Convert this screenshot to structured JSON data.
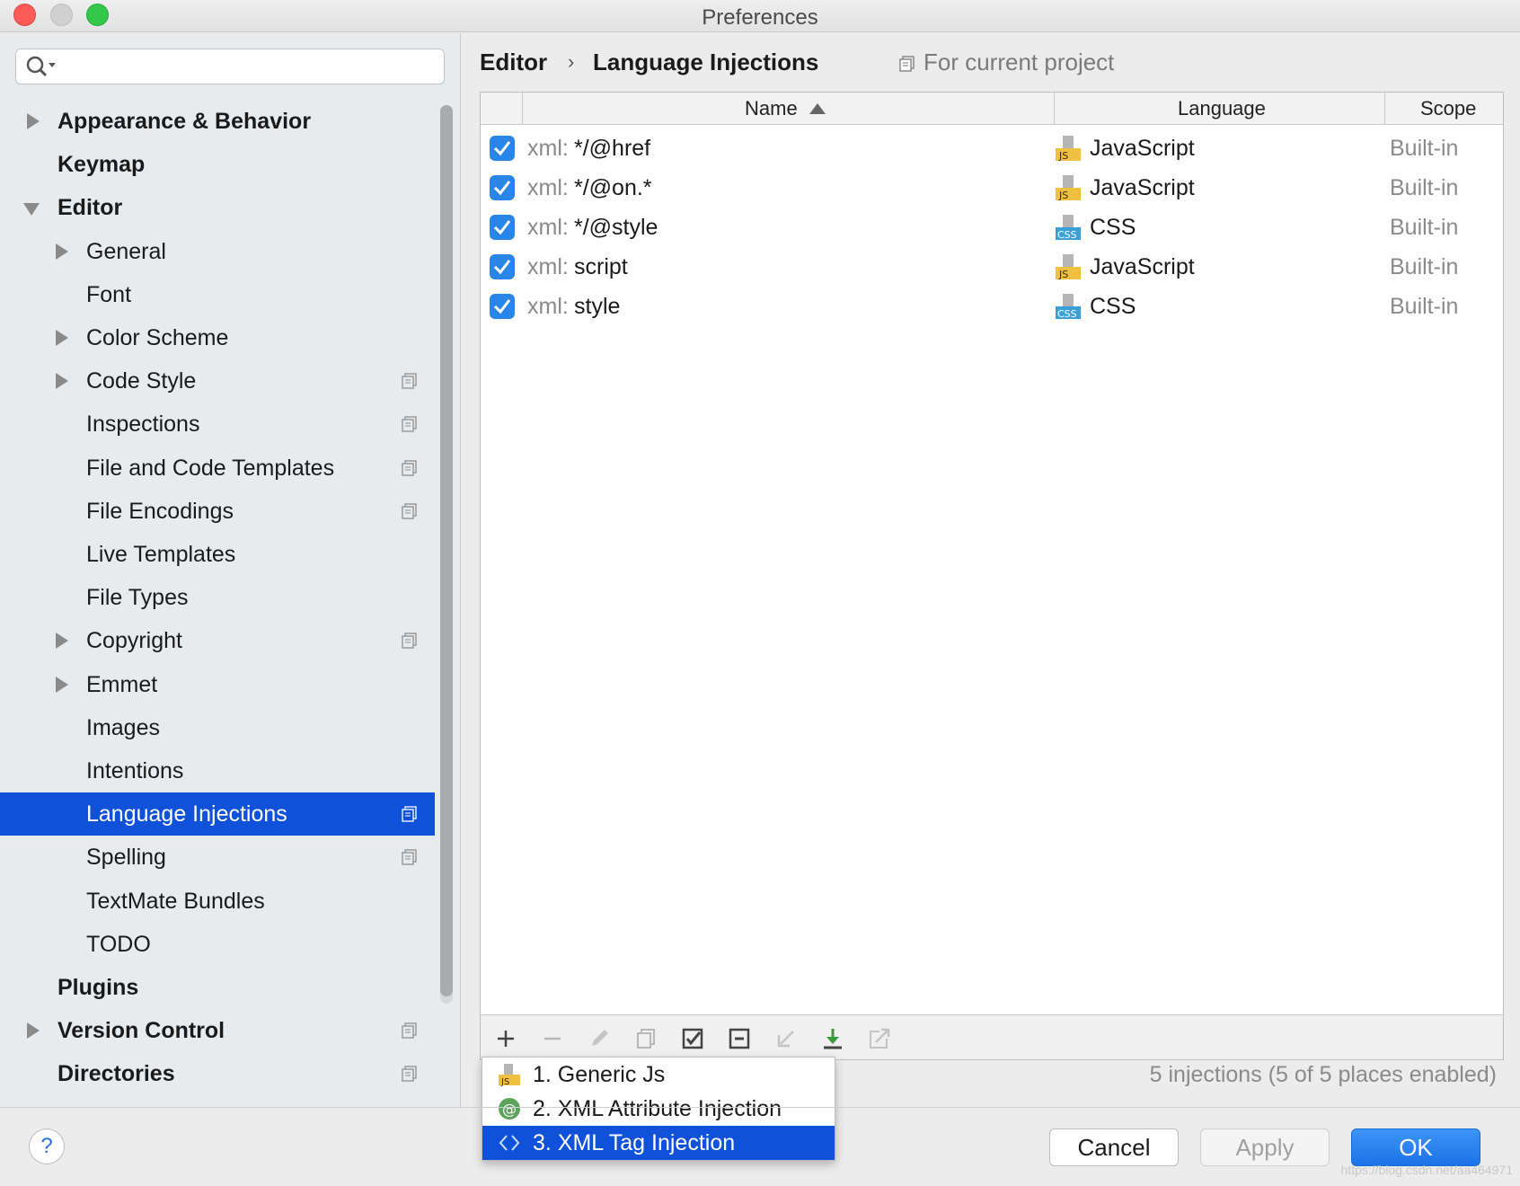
{
  "window": {
    "title": "Preferences"
  },
  "search": {
    "placeholder": ""
  },
  "sidebar": {
    "items": [
      {
        "label": "Appearance & Behavior",
        "level": 0,
        "expander": "collapsed",
        "project": false,
        "selected": false
      },
      {
        "label": "Keymap",
        "level": 0,
        "expander": "none",
        "project": false,
        "selected": false
      },
      {
        "label": "Editor",
        "level": 0,
        "expander": "expanded",
        "project": false,
        "selected": false
      },
      {
        "label": "General",
        "level": 1,
        "expander": "collapsed",
        "project": false,
        "selected": false
      },
      {
        "label": "Font",
        "level": 1,
        "expander": "none",
        "project": false,
        "selected": false
      },
      {
        "label": "Color Scheme",
        "level": 1,
        "expander": "collapsed",
        "project": false,
        "selected": false
      },
      {
        "label": "Code Style",
        "level": 1,
        "expander": "collapsed",
        "project": true,
        "selected": false
      },
      {
        "label": "Inspections",
        "level": 1,
        "expander": "none",
        "project": true,
        "selected": false
      },
      {
        "label": "File and Code Templates",
        "level": 1,
        "expander": "none",
        "project": true,
        "selected": false
      },
      {
        "label": "File Encodings",
        "level": 1,
        "expander": "none",
        "project": true,
        "selected": false
      },
      {
        "label": "Live Templates",
        "level": 1,
        "expander": "none",
        "project": false,
        "selected": false
      },
      {
        "label": "File Types",
        "level": 1,
        "expander": "none",
        "project": false,
        "selected": false
      },
      {
        "label": "Copyright",
        "level": 1,
        "expander": "collapsed",
        "project": true,
        "selected": false
      },
      {
        "label": "Emmet",
        "level": 1,
        "expander": "collapsed",
        "project": false,
        "selected": false
      },
      {
        "label": "Images",
        "level": 1,
        "expander": "none",
        "project": false,
        "selected": false
      },
      {
        "label": "Intentions",
        "level": 1,
        "expander": "none",
        "project": false,
        "selected": false
      },
      {
        "label": "Language Injections",
        "level": 1,
        "expander": "none",
        "project": true,
        "selected": true
      },
      {
        "label": "Spelling",
        "level": 1,
        "expander": "none",
        "project": true,
        "selected": false
      },
      {
        "label": "TextMate Bundles",
        "level": 1,
        "expander": "none",
        "project": false,
        "selected": false
      },
      {
        "label": "TODO",
        "level": 1,
        "expander": "none",
        "project": false,
        "selected": false
      },
      {
        "label": "Plugins",
        "level": 0,
        "expander": "none",
        "project": false,
        "selected": false
      },
      {
        "label": "Version Control",
        "level": 0,
        "expander": "collapsed",
        "project": true,
        "selected": false
      },
      {
        "label": "Directories",
        "level": 0,
        "expander": "none",
        "project": true,
        "selected": false
      }
    ]
  },
  "breadcrumb": {
    "parent": "Editor",
    "separator": "›",
    "current": "Language Injections"
  },
  "project_note": "For current project",
  "table": {
    "columns": {
      "name": "Name",
      "language": "Language",
      "scope": "Scope"
    },
    "rows": [
      {
        "checked": true,
        "prefix": "xml:",
        "name": "*/@href",
        "language": "JavaScript",
        "lang_icon": "js-icon",
        "scope": "Built-in"
      },
      {
        "checked": true,
        "prefix": "xml:",
        "name": "*/@on.*",
        "language": "JavaScript",
        "lang_icon": "js-icon",
        "scope": "Built-in"
      },
      {
        "checked": true,
        "prefix": "xml:",
        "name": "*/@style",
        "language": "CSS",
        "lang_icon": "css-icon",
        "scope": "Built-in"
      },
      {
        "checked": true,
        "prefix": "xml:",
        "name": "script",
        "language": "JavaScript",
        "lang_icon": "js-icon",
        "scope": "Built-in"
      },
      {
        "checked": true,
        "prefix": "xml:",
        "name": "style",
        "language": "CSS",
        "lang_icon": "css-icon",
        "scope": "Built-in"
      }
    ]
  },
  "toolbar": {
    "icons": [
      "plus-icon",
      "minus-icon",
      "edit-icon",
      "copy-icon",
      "enable-all-icon",
      "disable-all-icon",
      "import-icon",
      "export-icon",
      "share-icon"
    ]
  },
  "status_text": "5 injections (5 of 5 places enabled)",
  "popup": {
    "items": [
      {
        "label": "1. Generic Js",
        "icon": "js-icon",
        "selected": false
      },
      {
        "label": "2. XML Attribute Injection",
        "icon": "at-icon",
        "selected": false
      },
      {
        "label": "3. XML Tag Injection",
        "icon": "tag-icon",
        "selected": true
      }
    ]
  },
  "buttons": {
    "help": "?",
    "cancel": "Cancel",
    "apply": "Apply",
    "ok": "OK"
  },
  "watermark": "https://blog.csdn.net/aa464971",
  "colors": {
    "selection": "#0f52d9",
    "checkbox": "#2a85e8",
    "ok_button": "#1b73e8",
    "js_badge": "#f0c040",
    "css_badge": "#3aa0d8"
  }
}
